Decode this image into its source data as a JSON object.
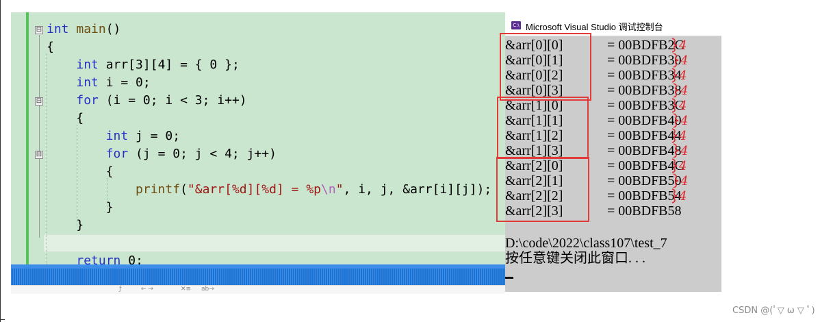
{
  "editor": {
    "lines": [
      {
        "parts": [
          {
            "t": "int",
            "c": "kw"
          },
          {
            "t": " "
          },
          {
            "t": "main",
            "c": "fn"
          },
          {
            "t": "()"
          }
        ]
      },
      {
        "parts": [
          {
            "t": "{"
          }
        ]
      },
      {
        "parts": [
          {
            "t": "    "
          },
          {
            "t": "int",
            "c": "kw"
          },
          {
            "t": " arr[3][4] = { 0 };"
          }
        ]
      },
      {
        "parts": [
          {
            "t": "    "
          },
          {
            "t": "int",
            "c": "kw"
          },
          {
            "t": " i = 0;"
          }
        ]
      },
      {
        "parts": [
          {
            "t": "    "
          },
          {
            "t": "for",
            "c": "kw"
          },
          {
            "t": " (i = 0; i < 3; i++)"
          }
        ]
      },
      {
        "parts": [
          {
            "t": "    {"
          }
        ]
      },
      {
        "parts": [
          {
            "t": "        "
          },
          {
            "t": "int",
            "c": "kw"
          },
          {
            "t": " j = 0;"
          }
        ]
      },
      {
        "parts": [
          {
            "t": "        "
          },
          {
            "t": "for",
            "c": "kw"
          },
          {
            "t": " (j = 0; j < 4; j++)"
          }
        ]
      },
      {
        "parts": [
          {
            "t": "        {"
          }
        ]
      },
      {
        "parts": [
          {
            "t": "            "
          },
          {
            "t": "printf",
            "c": "fn"
          },
          {
            "t": "("
          },
          {
            "t": "\"&arr[%d][%d] = %p",
            "c": "str"
          },
          {
            "t": "\\n",
            "c": "esc"
          },
          {
            "t": "\"",
            "c": "str"
          },
          {
            "t": ", i, j, &arr[i][j]);"
          }
        ]
      },
      {
        "parts": [
          {
            "t": "        }"
          }
        ]
      },
      {
        "parts": [
          {
            "t": "    }"
          }
        ]
      },
      {
        "parts": [
          {
            "t": ""
          }
        ]
      },
      {
        "parts": [
          {
            "t": "    "
          },
          {
            "t": "return",
            "c": "kw"
          },
          {
            "t": " 0;"
          }
        ]
      }
    ],
    "fold_marks": [
      "⊟",
      "⊟",
      "⊟"
    ]
  },
  "toolbar": {
    "items": [
      "ƒ",
      "←  →",
      "✕≡",
      "ab→"
    ]
  },
  "console": {
    "title": "Microsoft Visual Studio 调试控制台",
    "icon_label": "C:\\",
    "rows": [
      {
        "label": "&arr[0][0]",
        "addr": "= 00BDFB2C"
      },
      {
        "label": "&arr[0][1]",
        "addr": "= 00BDFB30"
      },
      {
        "label": "&arr[0][2]",
        "addr": "= 00BDFB34"
      },
      {
        "label": "&arr[0][3]",
        "addr": "= 00BDFB38"
      },
      {
        "label": "&arr[1][0]",
        "addr": "= 00BDFB3C"
      },
      {
        "label": "&arr[1][1]",
        "addr": "= 00BDFB40"
      },
      {
        "label": "&arr[1][2]",
        "addr": "= 00BDFB44"
      },
      {
        "label": "&arr[1][3]",
        "addr": "= 00BDFB48"
      },
      {
        "label": "&arr[2][0]",
        "addr": "= 00BDFB4C"
      },
      {
        "label": "&arr[2][1]",
        "addr": "= 00BDFB50"
      },
      {
        "label": "&arr[2][2]",
        "addr": "= 00BDFB54"
      },
      {
        "label": "&arr[2][3]",
        "addr": "= 00BDFB58"
      }
    ],
    "path_line": "D:\\code\\2022\\class107\\test_7",
    "prompt_line": "按任意键关闭此窗口. . ."
  },
  "annotations": {
    "handwritten_gap": "4",
    "gap_count": 11,
    "ink_color": "#e0292f",
    "box_color": "#e23b3b"
  },
  "watermark": "CSDN @(ﾟ▽ ω ▽ ﾟ)"
}
